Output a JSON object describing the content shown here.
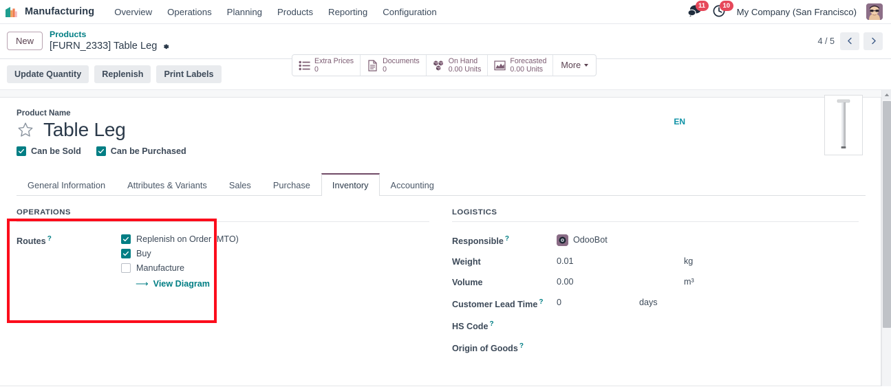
{
  "navbar": {
    "app_icon": "manufacturing-bars-icon",
    "brand": "Manufacturing",
    "menu": [
      {
        "label": "Overview"
      },
      {
        "label": "Operations"
      },
      {
        "label": "Planning"
      },
      {
        "label": "Products"
      },
      {
        "label": "Reporting"
      },
      {
        "label": "Configuration"
      }
    ],
    "messages_icon": "chat-bubbles-icon",
    "messages_count": "11",
    "activities_icon": "clock-icon",
    "activities_count": "10",
    "company": "My Company (San Francisco)",
    "avatar_icon": "user-avatar"
  },
  "control_panel": {
    "new_label": "New",
    "breadcrumb_parent": "Products",
    "breadcrumb_current": "[FURN_2333] Table Leg",
    "settings_icon": "gear-icon",
    "stat_buttons": [
      {
        "icon": "list-icon",
        "label": "Extra Prices",
        "value": "0"
      },
      {
        "icon": "document-icon",
        "label": "Documents",
        "value": "0"
      },
      {
        "icon": "boxes-icon",
        "label": "On Hand",
        "value": "0.00 Units"
      },
      {
        "icon": "area-chart-icon",
        "label": "Forecasted",
        "value": "0.00 Units"
      }
    ],
    "more_label": "More",
    "pager": "4 / 5",
    "prev_icon": "chevron-left-icon",
    "next_icon": "chevron-right-icon"
  },
  "action_bar": {
    "buttons": [
      {
        "label": "Update Quantity"
      },
      {
        "label": "Replenish"
      },
      {
        "label": "Print Labels"
      }
    ]
  },
  "form": {
    "product_name_label": "Product Name",
    "star_icon": "star-outline-icon",
    "product_name": "Table Leg",
    "can_be_sold": {
      "label": "Can be Sold",
      "checked": true
    },
    "can_be_purchased": {
      "label": "Can be Purchased",
      "checked": true
    },
    "language_badge": "EN",
    "product_image": "table-leg-photo"
  },
  "tabs": [
    {
      "label": "General Information",
      "active": false
    },
    {
      "label": "Attributes & Variants",
      "active": false
    },
    {
      "label": "Sales",
      "active": false
    },
    {
      "label": "Purchase",
      "active": false
    },
    {
      "label": "Inventory",
      "active": true
    },
    {
      "label": "Accounting",
      "active": false
    }
  ],
  "inventory": {
    "operations": {
      "title": "OPERATIONS",
      "routes_label": "Routes",
      "routes": [
        {
          "label": "Replenish on Order (MTO)",
          "checked": true
        },
        {
          "label": "Buy",
          "checked": true
        },
        {
          "label": "Manufacture",
          "checked": false
        }
      ],
      "view_diagram": "View Diagram",
      "view_diagram_icon": "arrow-right-icon"
    },
    "logistics": {
      "title": "LOGISTICS",
      "responsible_label": "Responsible",
      "responsible_value": "OdooBot",
      "responsible_avatar": "odoobot-avatar",
      "weight_label": "Weight",
      "weight_value": "0.01",
      "weight_unit": "kg",
      "volume_label": "Volume",
      "volume_value": "0.00",
      "volume_unit": "m³",
      "lead_time_label": "Customer Lead Time",
      "lead_time_value": "0",
      "lead_time_unit": "days",
      "hs_code_label": "HS Code",
      "origin_label": "Origin of Goods"
    }
  },
  "annotation": {
    "highlight_color": "#fc0d1b",
    "target": "operations-section"
  },
  "colors": {
    "accent_teal": "#017e84",
    "brand_purple": "#714b67",
    "badge_red": "#e6485a"
  }
}
